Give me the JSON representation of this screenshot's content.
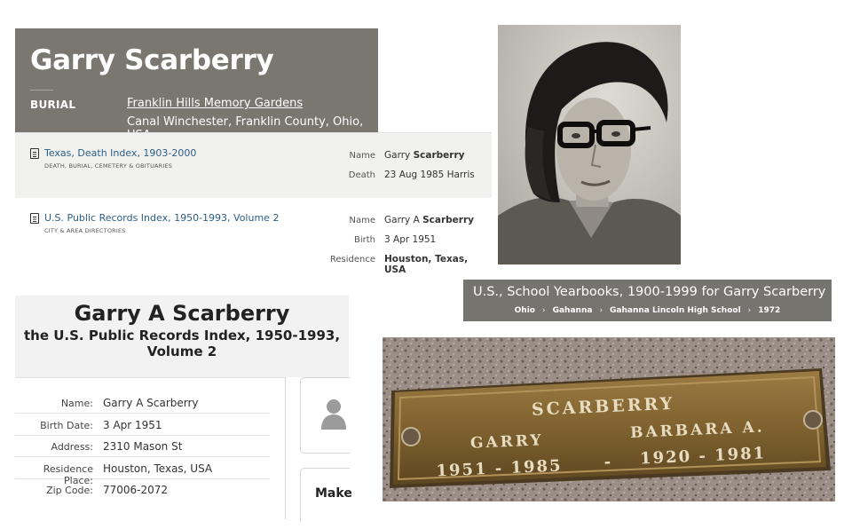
{
  "findagrave": {
    "name": "Garry Scarberry",
    "burial_label": "BURIAL",
    "cemetery": "Franklin Hills Memory Gardens",
    "location": "Canal Winchester, Franklin County, Ohio, USA"
  },
  "results": [
    {
      "title": "Texas, Death Index, 1903-2000",
      "category": "DEATH, BURIAL, CEMETERY & OBITUARIES",
      "fields": [
        {
          "label": "Name",
          "value_plain": "Garry ",
          "value_bold": "Scarberry"
        },
        {
          "label": "Death",
          "value_plain": "23 Aug 1985 Harris",
          "value_bold": ""
        }
      ]
    },
    {
      "title": "U.S. Public Records Index, 1950-1993, Volume 2",
      "category": "CITY & AREA DIRECTORIES",
      "fields": [
        {
          "label": "Name",
          "value_plain": "Garry A ",
          "value_bold": "Scarberry"
        },
        {
          "label": "Birth",
          "value_plain": "3 Apr 1951",
          "value_bold": ""
        },
        {
          "label": "Residence",
          "value_plain": "",
          "value_bold": "Houston, Texas, USA"
        }
      ]
    }
  ],
  "yearbook": {
    "title": "U.S., School Yearbooks, 1900-1999 for Garry Scarberry",
    "breadcrumbs": [
      "Ohio",
      "Gahanna",
      "Gahanna Lincoln High School",
      "1972"
    ]
  },
  "public_record": {
    "name": "Garry A Scarberry",
    "collection": "the U.S. Public Records Index, 1950-1993, Volume 2",
    "rows": [
      {
        "label": "Name:",
        "value": "Garry A Scarberry"
      },
      {
        "label": "Birth Date:",
        "value": "3 Apr 1951"
      },
      {
        "label": "Address:",
        "value": "2310 Mason St"
      },
      {
        "label": "Residence Place:",
        "value": "Houston, Texas, USA"
      },
      {
        "label": "Zip Code:",
        "value": "77006-2072"
      }
    ],
    "side_button": "Make"
  },
  "grave_marker": {
    "surname": "SCARBERRY",
    "left_name": "GARRY",
    "left_dates": "1951 - 1985",
    "dash": "-",
    "right_name": "BARBARA A.",
    "right_dates": "1920 - 1981"
  },
  "colors": {
    "header_gray": "#7a7770",
    "banner_gray": "#76746f",
    "link_blue": "#2c5e86",
    "bronze": "#8a6a35"
  }
}
